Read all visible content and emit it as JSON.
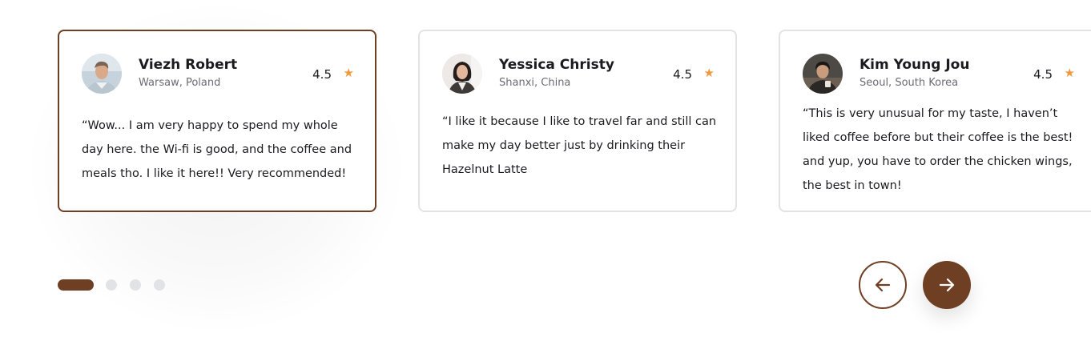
{
  "testimonials": [
    {
      "name": "Viezh Robert",
      "location": "Warsaw, Poland",
      "rating": "4.5",
      "quote": "“Wow... I am very happy to spend my whole day here. the Wi-fi is good, and the coffee and meals tho. I like it here!! Very recommended!",
      "active": true
    },
    {
      "name": "Yessica Christy",
      "location": "Shanxi, China",
      "rating": "4.5",
      "quote": "“I like it because I like to travel far and still can make my day better just by drinking their Hazelnut Latte",
      "active": false
    },
    {
      "name": "Kim Young Jou",
      "location": "Seoul, South Korea",
      "rating": "4.5",
      "quote": "“This is very unusual for my taste, I haven’t liked coffee before but their coffee is the best! and yup, you have to order the chicken wings, the best in town!",
      "active": false
    }
  ],
  "pagination": {
    "total": 4,
    "current": 1
  },
  "icons": {
    "rating": "star-icon",
    "prev": "arrow-left-icon",
    "next": "arrow-right-icon"
  },
  "colors": {
    "accent": "#6f3f24",
    "star": "#f0993c",
    "card_border": "#e3e3e6",
    "dot_inactive": "#e2e3e7"
  }
}
